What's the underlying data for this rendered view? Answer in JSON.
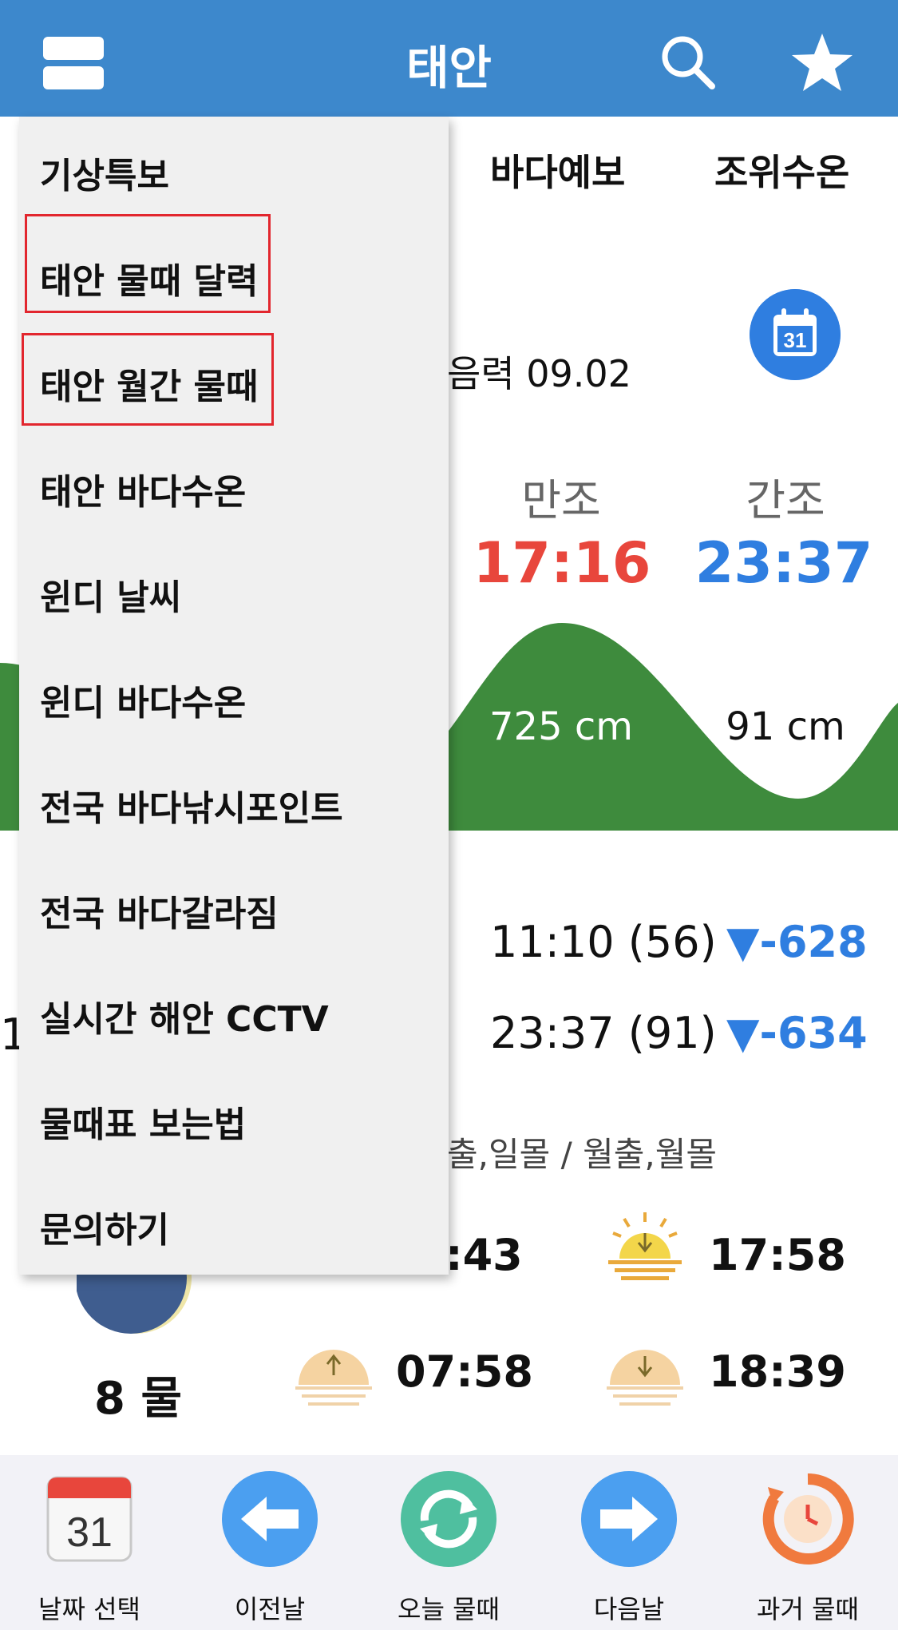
{
  "header": {
    "title": "태안"
  },
  "tabs": [
    {
      "label": "바다예보"
    },
    {
      "label": "조위수온"
    }
  ],
  "lunar_date": "음력 09.02",
  "tide": {
    "high_label": "만조",
    "low_label": "간조",
    "high_time": "17:16",
    "low_time": "23:37",
    "high_height": "725 cm",
    "low_height": "91 cm"
  },
  "tide_rows": [
    {
      "time": "11:10 (56)",
      "diff": "▼-628"
    },
    {
      "time": "23:37 (91)",
      "diff": "▼-634"
    }
  ],
  "side_fragment": "1",
  "sunmoon": {
    "label": "출,일몰 / 월출,월몰",
    "sunrise": ":43",
    "sunset": "17:58",
    "moonrise": "07:58",
    "moonset": "18:39"
  },
  "moon": {
    "label": "8 물"
  },
  "menu": {
    "items": [
      "기상특보",
      "태안 물때 달력",
      "태안 월간 물때",
      "태안 바다수온",
      "윈디 날씨",
      "윈디 바다수온",
      "전국 바다낚시포인트",
      "전국 바다갈라짐",
      "실시간 해안 CCTV",
      "물때표 보는법",
      "문의하기"
    ]
  },
  "toolbar": {
    "date_select": "날짜 선택",
    "prev_day": "이전날",
    "today_tide": "오늘 물때",
    "next_day": "다음날",
    "past_tide": "과거 물때",
    "calendar_day": "31"
  },
  "calendar_button_day": "31",
  "colors": {
    "header": "#3d88cc",
    "high": "#e8463c",
    "low": "#2f7ee0",
    "wave": "#3e8b3d",
    "highlight": "#e2262e"
  }
}
